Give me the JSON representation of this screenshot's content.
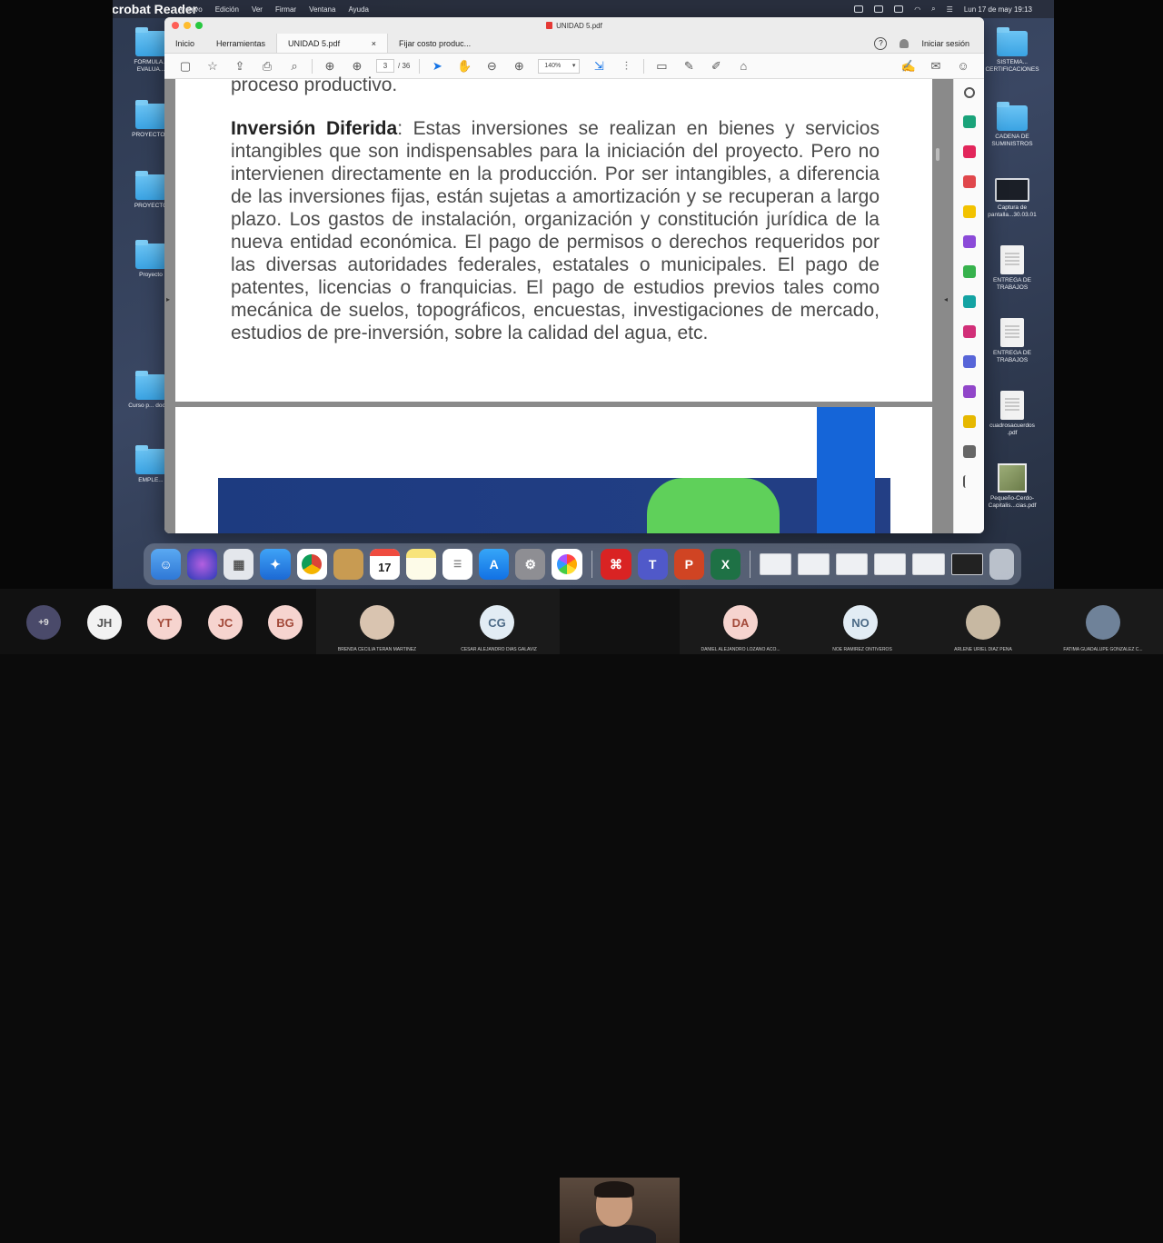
{
  "menubar": {
    "app": "Acrobat Reader",
    "items": [
      "Archivo",
      "Edición",
      "Ver",
      "Firmar",
      "Ventana",
      "Ayuda"
    ],
    "clock": "Lun 17 de may  19:13"
  },
  "desktop": {
    "left_icons": [
      "FORMULA... EVALUA... ",
      "PROYECTO...",
      "PROYECTO",
      "Proyecto",
      "Curso p... doce...",
      "EMPLE..."
    ],
    "right_icons": [
      "SISTEMA... CERTIFICACIONES",
      "CADENA DE SUMINISTROS",
      "Captura de pantalla...30.03.01",
      "ENTREGA DE TRABAJOS",
      "ENTREGA DE TRABAJOS",
      "cuadrosacuerdos .pdf",
      "Pequeño-Cerdo-Capitalis...cias.pdf"
    ]
  },
  "window": {
    "title": "UNIDAD 5.pdf",
    "tabs": {
      "home": "Inicio",
      "tools": "Herramientas",
      "active_doc": "UNIDAD 5.pdf",
      "other_doc": "Fijar costo produc..."
    },
    "help": "?",
    "signin": "Iniciar sesión"
  },
  "toolbar": {
    "page_current": "3",
    "page_total": "/ 36",
    "zoom": "140%"
  },
  "document": {
    "fragment": "proceso productivo.",
    "heading": "Inversión Diferida",
    "body": ": Estas inversiones se realizan en bienes y servicios intangibles que son indispensables para la iniciación del proyecto. Pero no intervienen directamente en la producción. Por ser intangibles, a diferencia de las inversiones fijas, están sujetas a amortización y se recuperan a largo plazo. Los gastos de instalación, organización y constitución jurídica de la nueva entidad económica. El pago de permisos o derechos requeridos por las diversas autoridades federales, estatales o municipales. El pago de patentes, licencias o franquicias. El pago de estudios previos tales como mecánica de suelos, topográficos, encuestas, investigaciones de mercado, estudios de pre-inversión, sobre la calidad del agua, etc."
  },
  "dock": {
    "calendar_day": "17"
  },
  "participants": {
    "more": "+9",
    "avatars": [
      {
        "initials": "JH",
        "color": "#f2f2f2",
        "text": "#555"
      },
      {
        "initials": "YT",
        "color": "#f6d4cf",
        "text": "#a34a3a"
      },
      {
        "initials": "JC",
        "color": "#f6d4cf",
        "text": "#a34a3a"
      },
      {
        "initials": "BG",
        "color": "#f6d4cf",
        "text": "#a34a3a"
      }
    ],
    "tiles": [
      {
        "name": "BRENDA CECILIA TERAN MARTINEZ"
      },
      {
        "initials": "CG",
        "name": "CESAR ALEJANDRO DIAS GALAVIZ"
      },
      {
        "initials": "DA",
        "name": "DANIEL ALEJANDRO LOZANO ACO..."
      },
      {
        "initials": "NO",
        "name": "NOE RAMIREZ ONTIVEROS"
      },
      {
        "name": "ARLENE URIEL DIAZ PENA"
      },
      {
        "name": "FATIMA GUADALUPE GONZALEZ C..."
      }
    ]
  }
}
